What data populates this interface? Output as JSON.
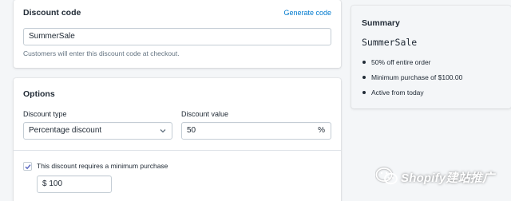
{
  "discount_code_card": {
    "title": "Discount code",
    "generate_link": "Generate code",
    "code_value": "SummerSale",
    "help_text": "Customers will enter this discount code at checkout."
  },
  "options_card": {
    "title": "Options",
    "discount_type_label": "Discount type",
    "discount_type_value": "Percentage discount",
    "discount_value_label": "Discount value",
    "discount_value": "50",
    "discount_value_suffix": "%",
    "min_purchase_checkbox_label": "This discount requires a minimum purchase",
    "min_purchase_checked": true,
    "min_purchase_value": "$ 100"
  },
  "summary_card": {
    "title": "Summary",
    "code": "SummerSale",
    "items": [
      "50% off entire order",
      "Minimum purchase of $100.00",
      "Active from today"
    ]
  },
  "watermark": {
    "text": "Shopify建站推广",
    "icon": "wechat-icon"
  },
  "colors": {
    "page_bg": "#f4f6f8",
    "link_blue": "#007ace",
    "checkbox_blue": "#5c6ac4",
    "text": "#212b36",
    "subdued_text": "#637381"
  }
}
